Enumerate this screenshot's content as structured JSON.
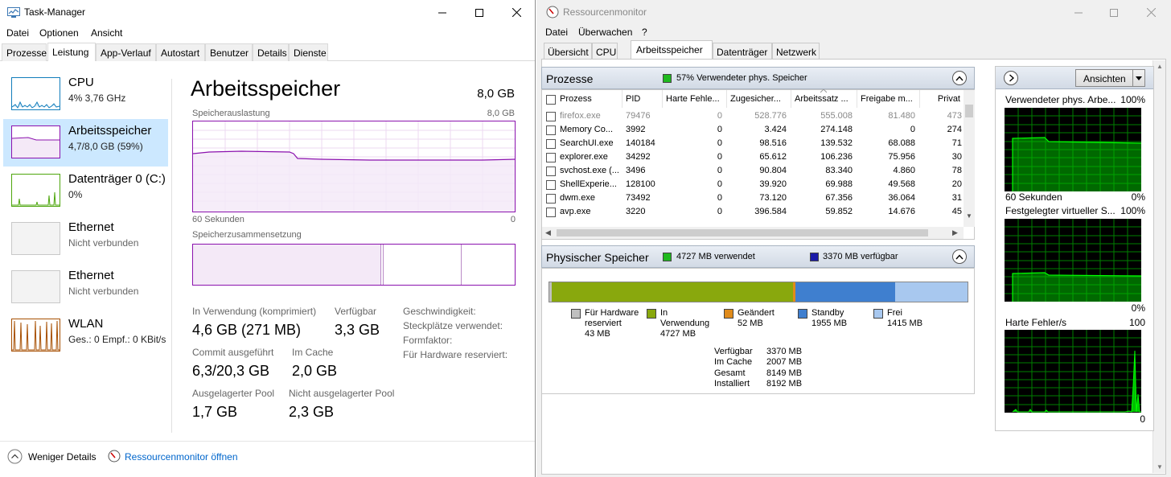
{
  "taskmanager": {
    "title": "Task-Manager",
    "menu": [
      "Datei",
      "Optionen",
      "Ansicht"
    ],
    "tabs": [
      "Prozesse",
      "Leistung",
      "App-Verlauf",
      "Autostart",
      "Benutzer",
      "Details",
      "Dienste"
    ],
    "active_tab": "Leistung",
    "sidebar": [
      {
        "name": "CPU",
        "sub": "4%  3,76 GHz",
        "color": "#117dbb"
      },
      {
        "name": "Arbeitsspeicher",
        "sub": "4,7/8,0 GB (59%)",
        "color": "#8b12ae"
      },
      {
        "name": "Datenträger 0 (C:)",
        "sub": "0%",
        "color": "#4da60c"
      },
      {
        "name": "Ethernet",
        "sub": "Nicht verbunden",
        "color": "#a7a7a7"
      },
      {
        "name": "Ethernet",
        "sub": "Nicht verbunden",
        "color": "#a7a7a7"
      },
      {
        "name": "WLAN",
        "sub": "Ges.: 0  Empf.: 0 KBit/s",
        "color": "#a74f01"
      }
    ],
    "memory": {
      "title": "Arbeitsspeicher",
      "total": "8,0 GB",
      "usage_label": "Speicherauslastung",
      "usage_max": "8,0 GB",
      "time_label": "60 Sekunden",
      "time_end": "0",
      "composition_label": "Speicherzusammensetzung",
      "stats": {
        "in_use_label": "In Verwendung (komprimiert)",
        "in_use_value": "4,6 GB (271 MB)",
        "available_label": "Verfügbar",
        "available_value": "3,3 GB",
        "commit_label": "Commit ausgeführt",
        "commit_value": "6,3/20,3 GB",
        "cache_label": "Im Cache",
        "cache_value": "2,0 GB",
        "paged_label": "Ausgelagerter Pool",
        "paged_value": "1,7 GB",
        "nonpaged_label": "Nicht ausgelagerter Pool",
        "nonpaged_value": "2,3 GB"
      },
      "info_labels": [
        "Geschwindigkeit:",
        "Steckplätze verwendet:",
        "Formfaktor:",
        "Für Hardware reserviert:"
      ]
    },
    "footer": {
      "less_details": "Weniger Details",
      "open_resmon": "Ressourcenmonitor öffnen"
    }
  },
  "resmon": {
    "title": "Ressourcenmonitor",
    "menu": [
      "Datei",
      "Überwachen",
      "?"
    ],
    "tabs": [
      "Übersicht",
      "CPU",
      "Arbeitsspeicher",
      "Datenträger",
      "Netzwerk"
    ],
    "active_tab": "Arbeitsspeicher",
    "processes": {
      "title": "Prozesse",
      "indicator": "57% Verwendeter phys. Speicher",
      "columns": [
        "Prozess",
        "PID",
        "Harte Fehle...",
        "Zugesicher...",
        "Arbeitssatz ...",
        "Freigabe m...",
        "Privat"
      ],
      "rows": [
        [
          "firefox.exe",
          "79476",
          "0",
          "528.776",
          "555.008",
          "81.480",
          "473"
        ],
        [
          "Memory Co...",
          "3992",
          "0",
          "3.424",
          "274.148",
          "0",
          "274"
        ],
        [
          "SearchUI.exe",
          "140184",
          "0",
          "98.516",
          "139.532",
          "68.088",
          "71"
        ],
        [
          "explorer.exe",
          "34292",
          "0",
          "65.612",
          "106.236",
          "75.956",
          "30"
        ],
        [
          "svchost.exe (...",
          "3496",
          "0",
          "90.804",
          "83.340",
          "4.860",
          "78"
        ],
        [
          "ShellExperie...",
          "128100",
          "0",
          "39.920",
          "69.988",
          "49.568",
          "20"
        ],
        [
          "dwm.exe",
          "73492",
          "0",
          "73.120",
          "67.356",
          "36.064",
          "31"
        ],
        [
          "avp.exe",
          "3220",
          "0",
          "396.584",
          "59.852",
          "14.676",
          "45"
        ]
      ]
    },
    "physical": {
      "title": "Physischer Speicher",
      "used_indicator": "4727 MB verwendet",
      "available_indicator": "3370 MB verfügbar",
      "legend": [
        {
          "label": "Für Hardware reserviert",
          "value": "43 MB",
          "color": "#c0c0c0",
          "mb": 43
        },
        {
          "label": "In Verwendung",
          "value": "4727 MB",
          "color": "#89a80d",
          "mb": 4727
        },
        {
          "label": "Geändert",
          "value": "52 MB",
          "color": "#e08b1b",
          "mb": 52
        },
        {
          "label": "Standby",
          "value": "1955 MB",
          "color": "#3f7fcf",
          "mb": 1955
        },
        {
          "label": "Frei",
          "value": "1415 MB",
          "color": "#a8c8ef",
          "mb": 1415
        }
      ],
      "summary": [
        {
          "label": "Verfügbar",
          "value": "3370 MB"
        },
        {
          "label": "Im Cache",
          "value": "2007 MB"
        },
        {
          "label": "Gesamt",
          "value": "8149 MB"
        },
        {
          "label": "Installiert",
          "value": "8192 MB"
        }
      ]
    },
    "graphs": {
      "view_button": "Ansichten",
      "items": [
        {
          "title": "Verwendeter phys. Arbe...",
          "max": "100%",
          "time": "60 Sekunden",
          "min": "0%"
        },
        {
          "title": "Festgelegter virtueller S...",
          "max": "100%",
          "time": "",
          "min": "0%"
        },
        {
          "title": "Harte Fehler/s",
          "max": "100",
          "time": "",
          "min": "0"
        }
      ]
    }
  }
}
